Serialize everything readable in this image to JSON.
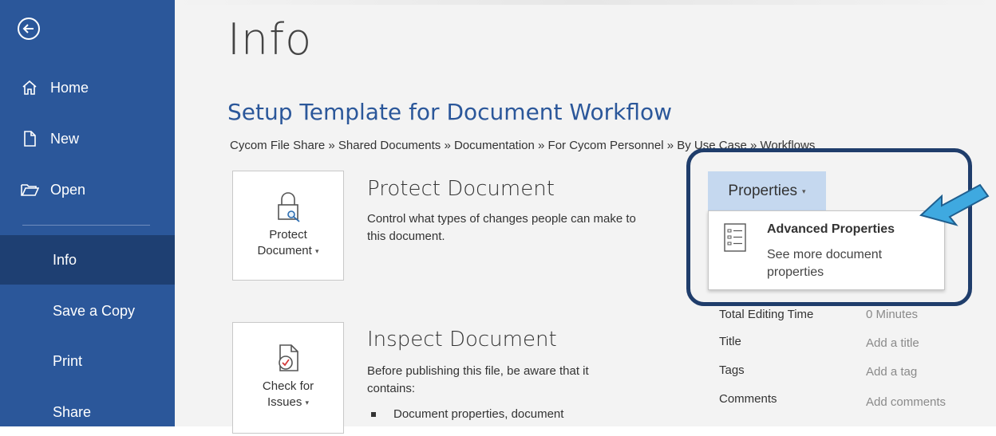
{
  "sidebar": {
    "back_icon": "back-arrow-circle-icon",
    "items": [
      {
        "label": "Home",
        "icon": "home-icon"
      },
      {
        "label": "New",
        "icon": "new-document-icon"
      },
      {
        "label": "Open",
        "icon": "open-folder-icon"
      },
      {
        "label": "Info"
      },
      {
        "label": "Save a Copy"
      },
      {
        "label": "Print"
      },
      {
        "label": "Share"
      }
    ],
    "active_item": "Info"
  },
  "main": {
    "page_title": "Info",
    "document_title": "Setup Template for Document Workflow",
    "breadcrumb": "Cycom File Share » Shared Documents » Documentation » For Cycom Personnel » By Use Case » Workflows",
    "protect": {
      "tile_line1": "Protect",
      "tile_line2": "Document",
      "heading": "Protect Document",
      "description": "Control what types of changes people can make to this document."
    },
    "inspect": {
      "tile_line1": "Check for",
      "tile_line2": "Issues",
      "heading": "Inspect Document",
      "description": "Before publishing this file, be aware that it contains:",
      "bullet": "Document properties, document"
    },
    "properties": {
      "button_label": "Properties",
      "menu": {
        "title": "Advanced Properties",
        "description": "See more document properties"
      },
      "rows": [
        {
          "key": "Total Editing Time",
          "value": "0 Minutes"
        },
        {
          "key": "Title",
          "value": "Add a title"
        },
        {
          "key": "Tags",
          "value": "Add a tag"
        },
        {
          "key": "Comments",
          "value": "Add comments"
        }
      ]
    }
  },
  "colors": {
    "sidebar_bg": "#2b579a",
    "sidebar_active": "#1e3f72",
    "accent_title": "#2b579a",
    "highlight_border": "#1f3d6b",
    "arrow": "#3fa9e0"
  }
}
